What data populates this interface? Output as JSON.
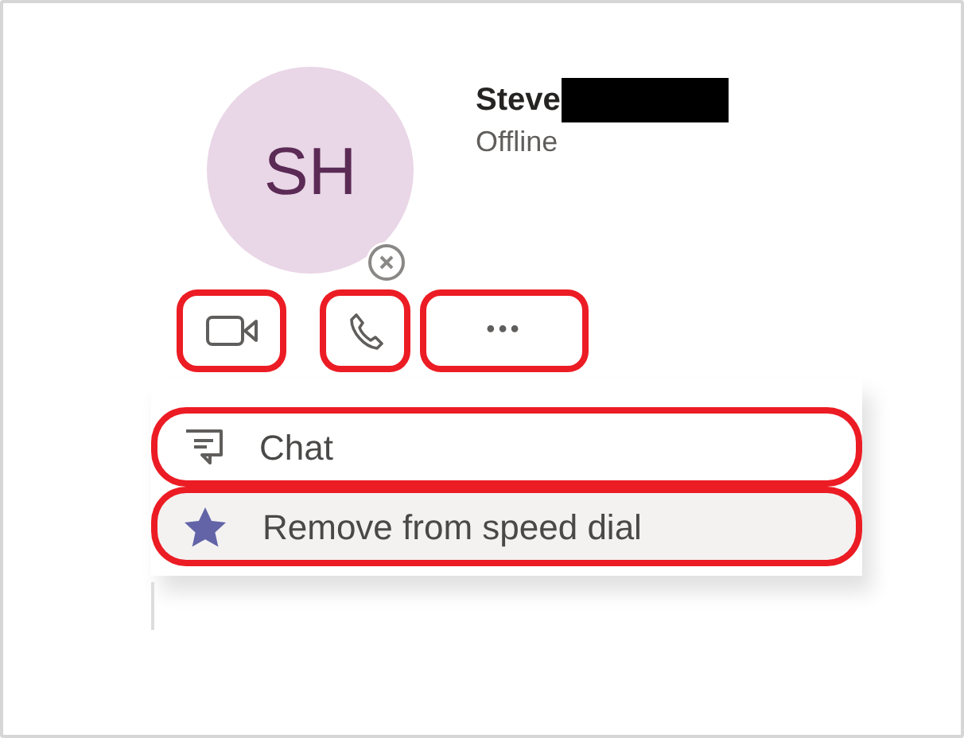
{
  "contact": {
    "initials": "SH",
    "name": "Steve",
    "name_redacted": true,
    "status": "Offline",
    "offline": true
  },
  "actions": [
    {
      "kind": "video",
      "highlighted": true
    },
    {
      "kind": "call",
      "highlighted": true
    },
    {
      "kind": "more",
      "label": "•••",
      "highlighted": true
    }
  ],
  "menu": [
    {
      "kind": "chat",
      "label": "Chat",
      "hovered": false,
      "highlighted": true
    },
    {
      "kind": "star",
      "label": "Remove from speed dial",
      "hovered": true,
      "highlighted": true
    }
  ]
}
